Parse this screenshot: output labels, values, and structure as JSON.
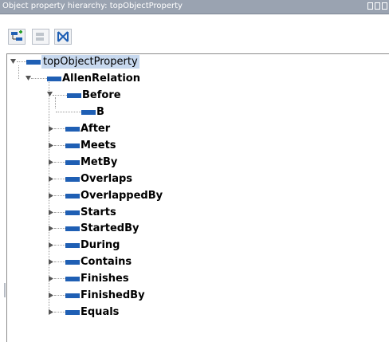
{
  "panel": {
    "title": "Object property hierarchy: topObjectProperty"
  },
  "toolbar": {
    "buttons": [
      {
        "name": "add-subproperty-icon",
        "enabled": true
      },
      {
        "name": "add-sibling-property-icon",
        "enabled": false
      },
      {
        "name": "delete-property-icon",
        "enabled": true
      }
    ]
  },
  "tree": {
    "root": "topObjectProperty",
    "child": "AllenRelation",
    "before": "Before",
    "before_child": "B",
    "items": [
      "After",
      "Meets",
      "MetBy",
      "Overlaps",
      "OverlappedBy",
      "Starts",
      "StartedBy",
      "During",
      "Contains",
      "Finishes",
      "FinishedBy",
      "Equals"
    ]
  },
  "colors": {
    "titlebar": "#9aa3b1",
    "node_bar": "#1f5fb4",
    "selection": "#c7d8ee"
  }
}
